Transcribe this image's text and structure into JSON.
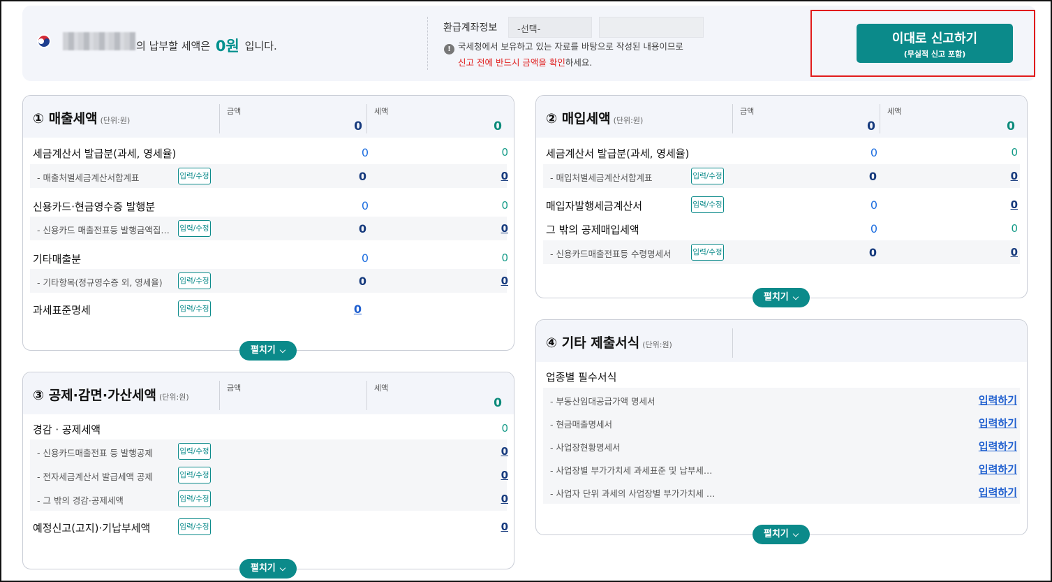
{
  "top": {
    "tax_message_prefix": "의 납부할 세액은",
    "tax_amount": "0원",
    "tax_message_suffix": "입니다.",
    "refund_label": "환급계좌정보",
    "refund_select": "-선택-",
    "notice_line1": "국세청에서 보유하고 있는 자료를 바탕으로 작성된 내용이므로",
    "notice_red": "신고 전에 반드시 금액을 확인",
    "notice_rest": "하세요.",
    "submit_main": "이대로 신고하기",
    "submit_sub": "(무실적 신고 포함)"
  },
  "common": {
    "unit": "(단위:원)",
    "amount_label": "금액",
    "tax_label": "세액",
    "edit_label": "입력/수정",
    "expand_label": "펼치기",
    "input_label": "입력하기"
  },
  "sales": {
    "title": "① 매출세액",
    "total_amount": "0",
    "total_tax": "0",
    "rows": [
      {
        "label": "세금계산서 발급분(과세, 영세율)",
        "amount": "0",
        "tax": "0"
      },
      {
        "label": "- 매출처별세금계산서합계표",
        "amount": "0",
        "tax": "0"
      },
      {
        "label": "신용카드·현금영수증 발행분",
        "amount": "0",
        "tax": "0"
      },
      {
        "label": "- 신용카드 매출전표등 발행금액집…",
        "amount": "0",
        "tax": "0"
      },
      {
        "label": "기타매출분",
        "amount": "0",
        "tax": "0"
      },
      {
        "label": "- 기타항목(정규영수증 외, 영세율)",
        "amount": "0",
        "tax": "0"
      },
      {
        "label": "과세표준명세",
        "amount": "0"
      }
    ]
  },
  "purchase": {
    "title": "② 매입세액",
    "total_amount": "0",
    "total_tax": "0",
    "rows": [
      {
        "label": "세금계산서 발급분(과세, 영세율)",
        "amount": "0",
        "tax": "0"
      },
      {
        "label": "- 매입처별세금계산서합계표",
        "amount": "0",
        "tax": "0"
      },
      {
        "label": "매입자발행세금계산서",
        "amount": "0",
        "tax": "0"
      },
      {
        "label": "그 밖의 공제매입세액",
        "amount": "0",
        "tax": "0"
      },
      {
        "label": "- 신용카드매출전표등 수령명세서",
        "amount": "0",
        "tax": "0"
      }
    ]
  },
  "deduction": {
    "title": "③ 공제·감면·가산세액",
    "total_tax": "0",
    "rows": [
      {
        "label": "경감 · 공제세액",
        "tax": "0"
      },
      {
        "label": "- 신용카드매출전표 등 발행공제",
        "tax": "0"
      },
      {
        "label": "- 전자세금계산서 발급세액 공제",
        "tax": "0"
      },
      {
        "label": "- 그 밖의 경감·공제세액",
        "tax": "0"
      },
      {
        "label": "예정신고(고지)·기납부세액",
        "tax": "0"
      }
    ]
  },
  "other": {
    "title": "④ 기타 제출서식",
    "section_label": "업종별 필수서식",
    "rows": [
      {
        "label": "- 부동산임대공급가액 명세서"
      },
      {
        "label": "- 현금매출명세서"
      },
      {
        "label": "- 사업장현황명세서"
      },
      {
        "label": "- 사업장별 부가가치세 과세표준 및 납부세…"
      },
      {
        "label": "- 사업자 단위 과세의 사업장별 부가가치세 …"
      }
    ]
  },
  "colors": {
    "accent": "#0b8a8a",
    "blue_value": "#1f6fe0",
    "teal_value": "#139a87",
    "alert": "#e11b1b"
  }
}
